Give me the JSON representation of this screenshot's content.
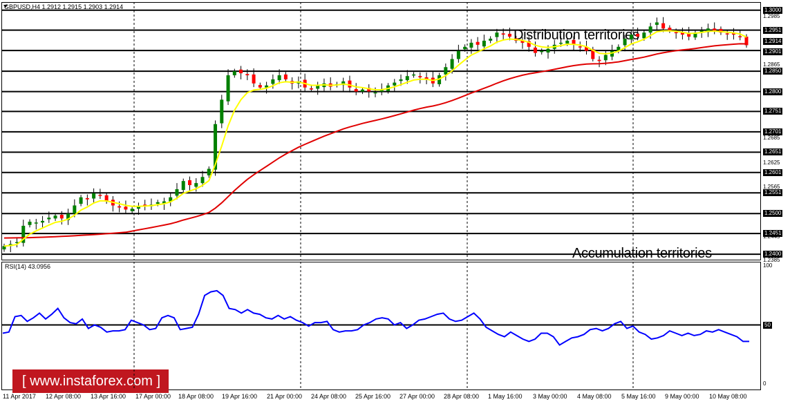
{
  "chart_title": "GBPUSD,H4  1.2912 1.2915 1.2903 1.2914",
  "rsi_title": "RSI(14) 43.0956",
  "annotations": {
    "distribution": "Distribution territories",
    "accumulation": "Accumulation territories"
  },
  "logo_text": "[  www.instaforex.com ]",
  "colors": {
    "candle_up": "#008000",
    "candle_down": "#ff0000",
    "ma_fast": "#ffff00",
    "ma_slow": "#e00000",
    "rsi_line": "#0000ff",
    "logo_bg": "#c0171f"
  },
  "price_labels": [
    {
      "text": "1.3000",
      "boxed": true
    },
    {
      "text": "1.2985",
      "boxed": false
    },
    {
      "text": "1.2951",
      "boxed": true
    },
    {
      "text": "1.2914",
      "boxed": true
    },
    {
      "text": "1.2901",
      "boxed": true
    },
    {
      "text": "1.2865",
      "boxed": false
    },
    {
      "text": "1.2850",
      "boxed": true
    },
    {
      "text": "1.2800",
      "boxed": true
    },
    {
      "text": "1.2751",
      "boxed": true
    },
    {
      "text": "1.2701",
      "boxed": true
    },
    {
      "text": "1.2685",
      "boxed": false
    },
    {
      "text": "1.2651",
      "boxed": true
    },
    {
      "text": "1.2625",
      "boxed": false
    },
    {
      "text": "1.2601",
      "boxed": true
    },
    {
      "text": "1.2565",
      "boxed": false
    },
    {
      "text": "1.2551",
      "boxed": true
    },
    {
      "text": "1.2500",
      "boxed": true
    },
    {
      "text": "1.2451",
      "boxed": true
    },
    {
      "text": "1.2445",
      "boxed": false
    },
    {
      "text": "1.2400",
      "boxed": true
    },
    {
      "text": "1.2385",
      "boxed": false
    }
  ],
  "horizontal_levels": [
    1.3,
    1.2951,
    1.2901,
    1.285,
    1.28,
    1.2751,
    1.2701,
    1.2651,
    1.2601,
    1.2551,
    1.25,
    1.2451,
    1.24
  ],
  "rsi_labels": [
    "100",
    "50",
    "0"
  ],
  "time_labels": [
    "11 Apr 2017",
    "12 Apr 08:00",
    "13 Apr 16:00",
    "17 Apr 00:00",
    "18 Apr 08:00",
    "19 Apr 16:00",
    "21 Apr 00:00",
    "24 Apr 08:00",
    "25 Apr 16:00",
    "27 Apr 00:00",
    "28 Apr 08:00",
    "1 May 16:00",
    "3 May 00:00",
    "4 May 08:00",
    "5 May 16:00",
    "9 May 00:00",
    "10 May 08:00"
  ],
  "chart_data": {
    "type": "line",
    "price_scale": [
      1.2385,
      1.302
    ],
    "candles_close": [
      1.242,
      1.2425,
      1.243,
      1.247,
      1.248,
      1.2478,
      1.2482,
      1.249,
      1.2495,
      1.2488,
      1.25,
      1.252,
      1.254,
      1.2535,
      1.255,
      1.2545,
      1.253,
      1.252,
      1.2515,
      1.251,
      1.2512,
      1.2518,
      1.252,
      1.2522,
      1.2528,
      1.253,
      1.254,
      1.256,
      1.258,
      1.257,
      1.2575,
      1.259,
      1.261,
      1.272,
      1.278,
      1.284,
      1.285,
      1.2845,
      1.284,
      1.282,
      1.281,
      1.2815,
      1.283,
      1.284,
      1.283,
      1.282,
      1.2825,
      1.281,
      1.2805,
      1.2815,
      1.282,
      1.2812,
      1.2818,
      1.2825,
      1.281,
      1.28,
      1.2805,
      1.28,
      1.2798,
      1.2805,
      1.2815,
      1.2822,
      1.283,
      1.2838,
      1.2842,
      1.2835,
      1.283,
      1.282,
      1.284,
      1.286,
      1.288,
      1.29,
      1.291,
      1.292,
      1.2915,
      1.2925,
      1.293,
      1.2945,
      1.294,
      1.2935,
      1.2925,
      1.292,
      1.291,
      1.2895,
      1.29,
      1.2905,
      1.2915,
      1.292,
      1.2925,
      1.2915,
      1.291,
      1.29,
      1.288,
      1.2875,
      1.289,
      1.29,
      1.291,
      1.293,
      1.294,
      1.2935,
      1.2945,
      1.296,
      1.297,
      1.2955,
      1.295,
      1.2945,
      1.294,
      1.2935,
      1.2945,
      1.295,
      1.2955,
      1.295,
      1.2945,
      1.2942,
      1.294,
      1.2935,
      1.2914
    ],
    "rsi_values": [
      43,
      44,
      57,
      58,
      53,
      56,
      60,
      55,
      59,
      64,
      56,
      52,
      51,
      55,
      47,
      50,
      48,
      44,
      45,
      45,
      46,
      54,
      52,
      50,
      46,
      47,
      56,
      58,
      56,
      46,
      47,
      48,
      59,
      75,
      78,
      79,
      75,
      64,
      63,
      60,
      63,
      60,
      59,
      56,
      55,
      58,
      55,
      57,
      54,
      52,
      49,
      52,
      52,
      53,
      46,
      44,
      45,
      45,
      46,
      50,
      52,
      55,
      56,
      55,
      50,
      52,
      47,
      50,
      54,
      55,
      57,
      59,
      60,
      55,
      53,
      54,
      57,
      60,
      55,
      48,
      45,
      42,
      40,
      44,
      41,
      38,
      36,
      38,
      43,
      43,
      40,
      33,
      36,
      39,
      40,
      42,
      46,
      47,
      45,
      47,
      51,
      53,
      47,
      49,
      44,
      42,
      38,
      39,
      41,
      45,
      43,
      41,
      43,
      41,
      42,
      45,
      44,
      46,
      44,
      42,
      40,
      36,
      36
    ]
  }
}
